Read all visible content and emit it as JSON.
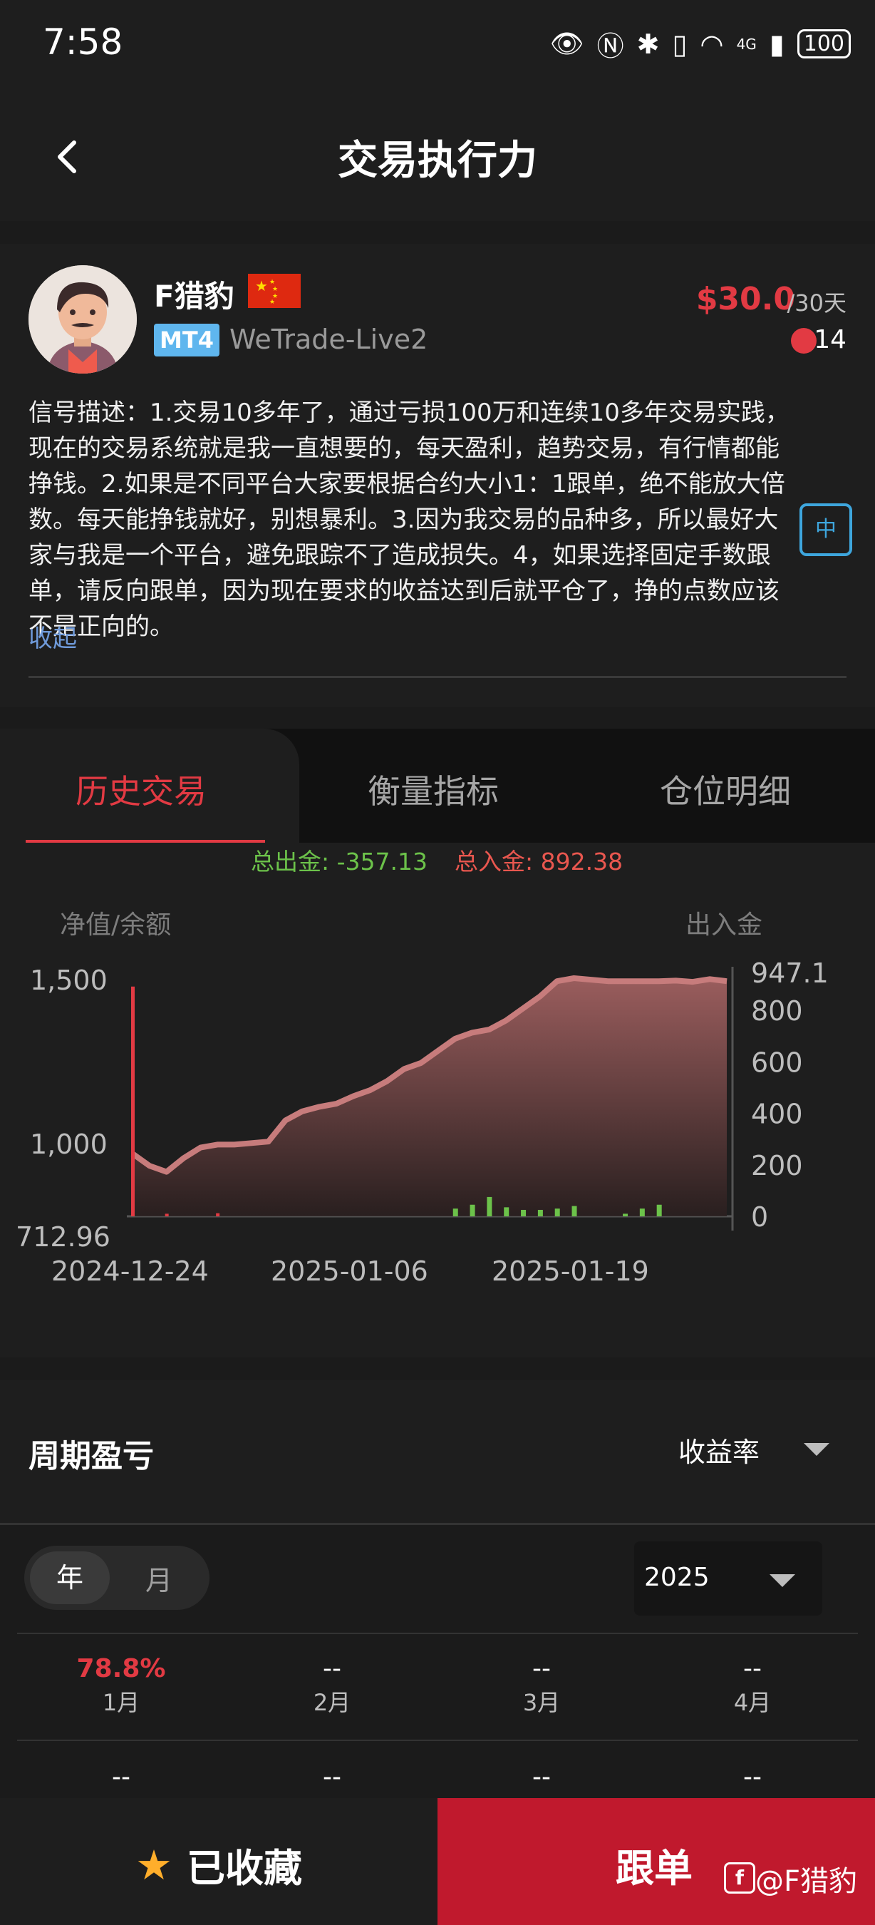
{
  "status": {
    "time": "7:58",
    "battery": "100",
    "network": "4G"
  },
  "header": {
    "title": "交易执行力"
  },
  "trader": {
    "name": "F猎豹",
    "platform": "MT4",
    "server": "WeTrade-Live2",
    "price": "$30.0",
    "period": "/30天",
    "followers": "14",
    "description": "信号描述：1.交易10多年了，通过亏损100万和连续10多年交易实践，现在的交易系统就是我一直想要的，每天盈利，趋势交易，有行情都能挣钱。2.如果是不同平台大家要根据合约大小1：1跟单，绝不能放大倍数。每天能挣钱就好，别想暴利。3.因为我交易的品种多，所以最好大家与我是一个平台，避免跟踪不了造成损失。4，如果选择固定手数跟单，请反向跟单，因为现在要求的收益达到后就平仓了，挣的点数应该不是正向的。",
    "collapse_label": "收起"
  },
  "tabs": [
    "历史交易",
    "衡量指标",
    "仓位明细"
  ],
  "totals": {
    "withdraw": "总出金: -357.13",
    "deposit": "总入金: 892.38"
  },
  "chart_data": {
    "type": "area",
    "left_axis_label": "净值/余额",
    "right_axis_label": "出入金",
    "left_ticks": [
      "1,500",
      "1,000",
      "712.96"
    ],
    "right_ticks": [
      "947.1",
      "800",
      "600",
      "400",
      "200",
      "0"
    ],
    "x_ticks": [
      "2024-12-24",
      "2025-01-06",
      "2025-01-19"
    ],
    "ylim_left": [
      712.96,
      1500
    ],
    "ylim_right": [
      0,
      947.1
    ],
    "equity": [
      [
        0,
        920
      ],
      [
        1,
        880
      ],
      [
        2,
        860
      ],
      [
        3,
        905
      ],
      [
        4,
        940
      ],
      [
        5,
        950
      ],
      [
        6,
        950
      ],
      [
        7,
        955
      ],
      [
        8,
        960
      ],
      [
        9,
        1030
      ],
      [
        10,
        1060
      ],
      [
        11,
        1075
      ],
      [
        12,
        1085
      ],
      [
        13,
        1110
      ],
      [
        14,
        1130
      ],
      [
        15,
        1160
      ],
      [
        16,
        1200
      ],
      [
        17,
        1220
      ],
      [
        18,
        1260
      ],
      [
        19,
        1300
      ],
      [
        20,
        1320
      ],
      [
        21,
        1330
      ],
      [
        22,
        1360
      ],
      [
        23,
        1400
      ],
      [
        24,
        1440
      ],
      [
        25,
        1490
      ],
      [
        26,
        1500
      ],
      [
        27,
        1495
      ],
      [
        28,
        1490
      ],
      [
        29,
        1490
      ],
      [
        30,
        1490
      ],
      [
        31,
        1490
      ],
      [
        32,
        1492
      ],
      [
        33,
        1488
      ],
      [
        34,
        1497
      ],
      [
        35,
        1490
      ]
    ],
    "deposits": [
      [
        0,
        892.38
      ],
      [
        2,
        10
      ],
      [
        5,
        12
      ]
    ],
    "withdrawals_bars": [
      [
        19,
        30
      ],
      [
        20,
        45
      ],
      [
        21,
        75
      ],
      [
        22,
        35
      ],
      [
        23,
        25
      ],
      [
        24,
        25
      ],
      [
        25,
        30
      ],
      [
        26,
        40
      ],
      [
        29,
        10
      ],
      [
        30,
        30
      ],
      [
        31,
        45
      ]
    ]
  },
  "period_pnl": {
    "title": "周期盈亏",
    "metric": "收益率",
    "toggle_year": "年",
    "toggle_month": "月",
    "year": "2025",
    "months": [
      {
        "value": "78.8%",
        "label": "1月"
      },
      {
        "value": "--",
        "label": "2月"
      },
      {
        "value": "--",
        "label": "3月"
      },
      {
        "value": "--",
        "label": "4月"
      }
    ],
    "row2": [
      "--",
      "--",
      "--",
      "--"
    ]
  },
  "bottom": {
    "favorite_label": "已收藏",
    "follow_label": "跟单",
    "watermark": "@F猎豹"
  },
  "colors": {
    "accent": "#e23a43",
    "follow_bg": "#c0192d",
    "mt4": "#5fb6ee",
    "positive": "#6cc24a"
  }
}
